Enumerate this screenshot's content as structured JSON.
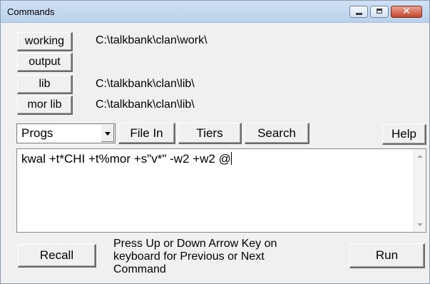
{
  "window": {
    "title": "Commands",
    "minimize_label": "",
    "maximize_label": "",
    "close_symbol": "✕"
  },
  "directories": [
    {
      "label": "working",
      "path": "C:\\talkbank\\clan\\work\\"
    },
    {
      "label": "output",
      "path": ""
    },
    {
      "label": "lib",
      "path": "C:\\talkbank\\clan\\lib\\"
    },
    {
      "label": "mor lib",
      "path": "C:\\talkbank\\clan\\lib\\"
    }
  ],
  "toolbar": {
    "progs_selected": "Progs",
    "file_in_label": "File In",
    "tiers_label": "Tiers",
    "search_label": "Search",
    "help_label": "Help"
  },
  "command": {
    "text": "kwal +t*CHI +t%mor +s\"v*\" -w2 +w2 @"
  },
  "bottom": {
    "recall_label": "Recall",
    "hint_line1": "Press Up or Down Arrow Key on",
    "hint_line2": "keyboard for Previous or Next",
    "hint_line3": "Command",
    "run_label": "Run"
  },
  "icons": {
    "minimize": "minimize-icon",
    "maximize": "maximize-icon",
    "close": "close-icon",
    "dropdown": "chevron-down-icon"
  },
  "colors": {
    "titlebar": "#b9d1ea",
    "close_button": "#c4452c",
    "window_bg": "#f0f0f0"
  }
}
